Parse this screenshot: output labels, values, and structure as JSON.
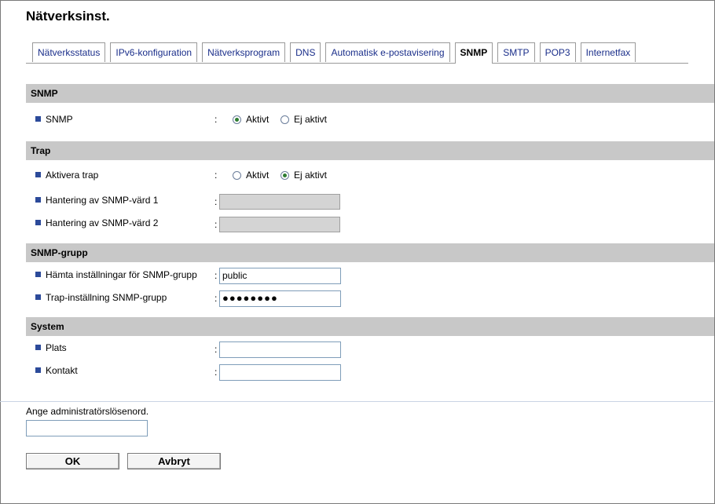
{
  "page": {
    "title": "Nätverksinst."
  },
  "tabs": [
    {
      "label": "Nätverksstatus"
    },
    {
      "label": "IPv6-konfiguration"
    },
    {
      "label": "Nätverksprogram"
    },
    {
      "label": "DNS"
    },
    {
      "label": "Automatisk e-postavisering"
    },
    {
      "label": "SNMP",
      "active": true
    },
    {
      "label": "SMTP"
    },
    {
      "label": "POP3"
    },
    {
      "label": "Internetfax"
    }
  ],
  "sections": {
    "snmp": {
      "header": "SNMP",
      "snmp_label": "SNMP",
      "colon": ":",
      "options": [
        "Aktivt",
        "Ej aktivt"
      ],
      "selected": "Aktivt"
    },
    "trap": {
      "header": "Trap",
      "activate_label": "Aktivera trap",
      "options": [
        "Aktivt",
        "Ej aktivt"
      ],
      "selected": "Ej aktivt",
      "host1_label": "Hantering av SNMP-värd 1",
      "host1_value": "",
      "host2_label": "Hantering av SNMP-värd 2",
      "host2_value": ""
    },
    "group": {
      "header": "SNMP-grupp",
      "get_label": "Hämta inställningar för SNMP-grupp",
      "get_value": "public",
      "trap_label": "Trap-inställning SNMP-grupp",
      "trap_value": "●●●●●●●●"
    },
    "system": {
      "header": "System",
      "location_label": "Plats",
      "location_value": "",
      "contact_label": "Kontakt",
      "contact_value": ""
    }
  },
  "admin": {
    "prompt": "Ange administratörslösenord.",
    "password_value": ""
  },
  "buttons": {
    "ok": "OK",
    "cancel": "Avbryt"
  },
  "colors": {
    "section_bg": "#c8c8c8",
    "tab_text": "#1a2e8a",
    "bullet": "#2c4a9a"
  }
}
